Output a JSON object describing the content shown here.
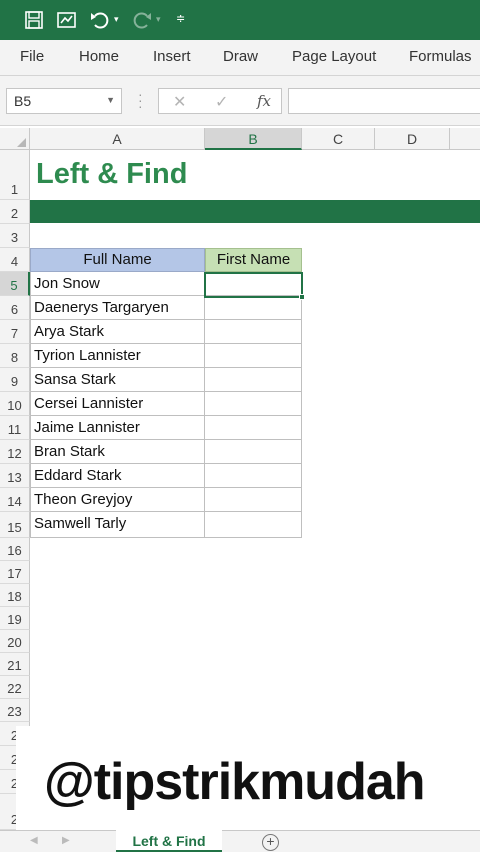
{
  "titlebar": {
    "icons": [
      "save-icon",
      "touch-mode-icon",
      "undo-icon",
      "redo-icon",
      "customize-icon"
    ]
  },
  "ribbon": {
    "tabs": [
      "File",
      "Home",
      "Insert",
      "Draw",
      "Page Layout",
      "Formulas"
    ]
  },
  "formula_bar": {
    "name_box": "B5",
    "formula": "",
    "cancel_glyph": "✕",
    "enter_glyph": "✓",
    "fx_glyph": "fx"
  },
  "grid": {
    "columns": [
      "A",
      "B",
      "C",
      "D"
    ],
    "active_column": "B",
    "active_row": "5",
    "rows": [
      "1",
      "2",
      "3",
      "4",
      "5",
      "6",
      "7",
      "8",
      "9",
      "10",
      "11",
      "12",
      "13",
      "14",
      "15",
      "16",
      "17",
      "18",
      "19",
      "20",
      "21",
      "22",
      "23",
      "2",
      "2",
      "2",
      "2"
    ]
  },
  "sheet": {
    "title": "Left & Find",
    "header_full_name": "Full Name",
    "header_first_name": "First Name",
    "names": [
      "Jon Snow",
      "Daenerys Targaryen",
      "Arya Stark",
      "Tyrion Lannister",
      "Sansa Stark",
      "Cersei Lannister",
      "Jaime Lannister",
      "Bran Stark",
      "Eddard Stark",
      "Theon Greyjoy",
      "Samwell Tarly"
    ],
    "first_names": [
      "",
      "",
      "",
      "",
      "",
      "",
      "",
      "",
      "",
      "",
      ""
    ]
  },
  "watermark": "@tipstrikmudah",
  "sheet_tabs": {
    "active": "Left & Find",
    "add_glyph": "+"
  },
  "colors": {
    "excel_green": "#217346",
    "header_blue": "#b4c6e7",
    "header_green": "#c6e0b4",
    "title_green": "#2e8b4f"
  }
}
